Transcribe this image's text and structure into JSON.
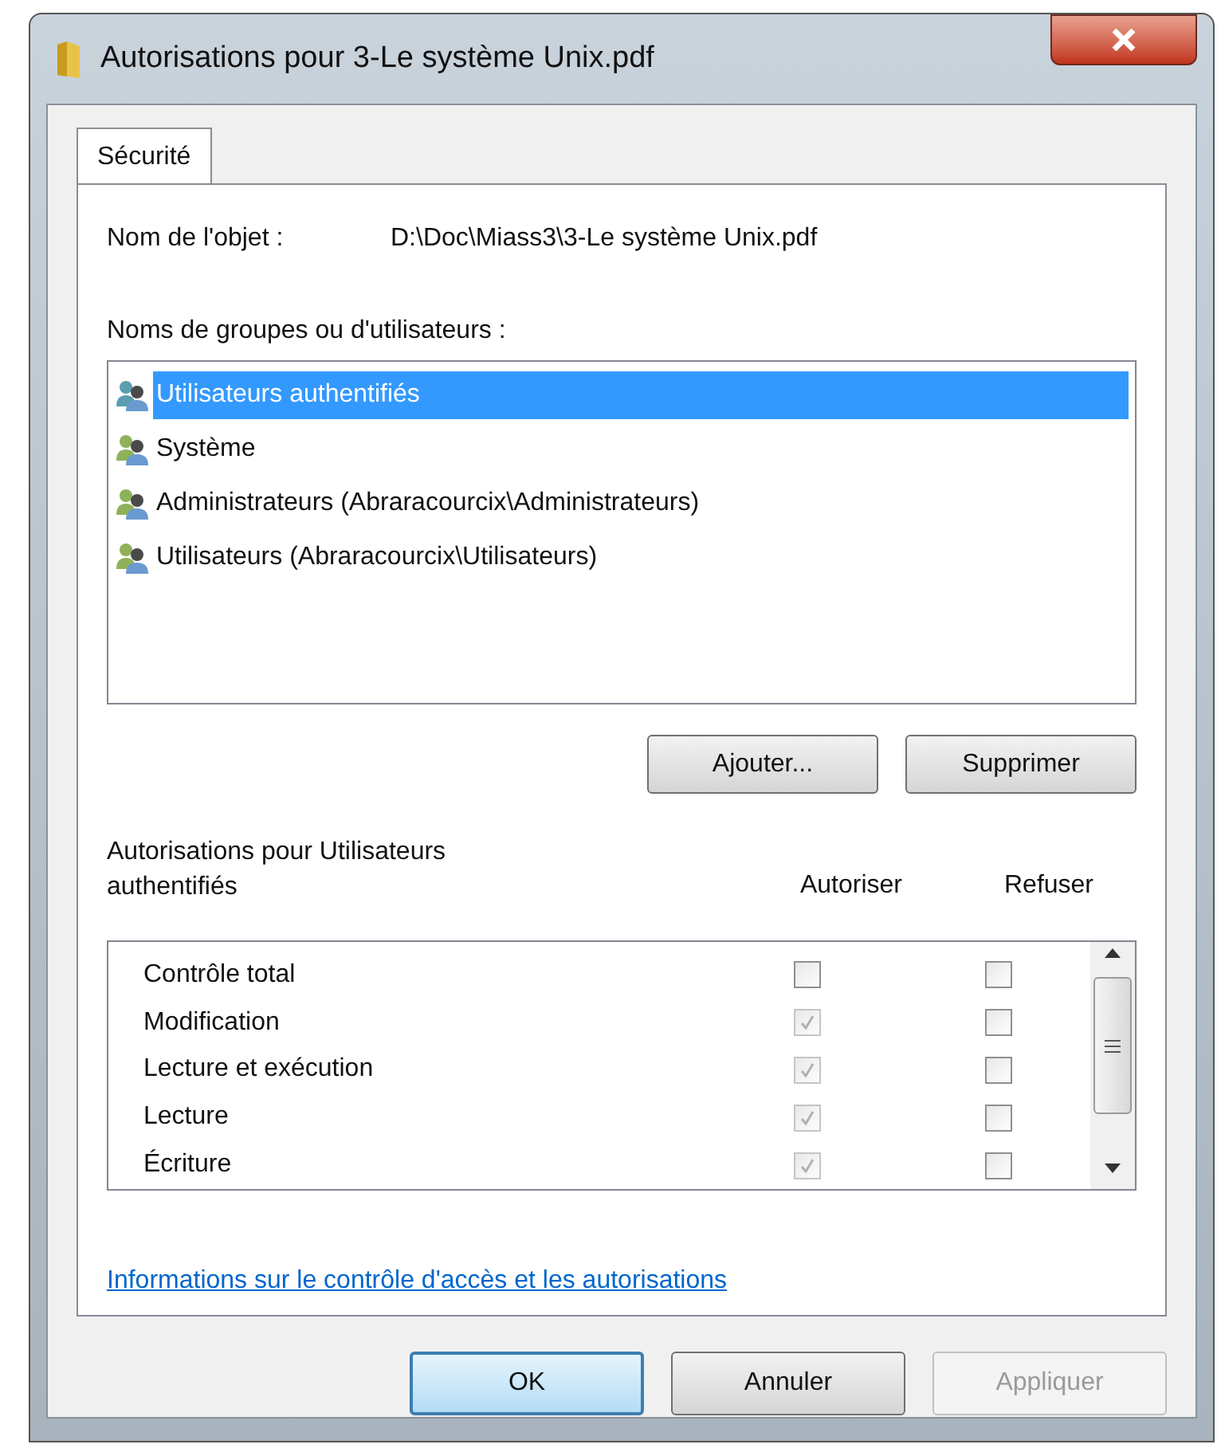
{
  "window": {
    "title": "Autorisations pour 3-Le système Unix.pdf"
  },
  "tabs": [
    {
      "label": "Sécurité",
      "selected": true
    }
  ],
  "object_name": {
    "label": "Nom de l'objet :",
    "value": "D:\\Doc\\Miass3\\3-Le système Unix.pdf"
  },
  "groups": {
    "label": "Noms de groupes ou d'utilisateurs :",
    "items": [
      {
        "name": "Utilisateurs authentifiés",
        "selected": true
      },
      {
        "name": "Système",
        "selected": false
      },
      {
        "name": "Administrateurs (Abraracourcix\\Administrateurs)",
        "selected": false
      },
      {
        "name": "Utilisateurs (Abraracourcix\\Utilisateurs)",
        "selected": false
      }
    ],
    "buttons": [
      {
        "label": "Ajouter..."
      },
      {
        "label": "Supprimer"
      }
    ]
  },
  "permissions": {
    "label": "Autorisations pour Utilisateurs authentifiés",
    "allow_header": "Autoriser",
    "deny_header": "Refuser",
    "rows": [
      {
        "name": "Contrôle total",
        "allow": {
          "checked": false,
          "disabled": false
        },
        "deny": {
          "checked": false,
          "disabled": false
        }
      },
      {
        "name": "Modification",
        "allow": {
          "checked": true,
          "disabled": true
        },
        "deny": {
          "checked": false,
          "disabled": false
        }
      },
      {
        "name": "Lecture et exécution",
        "allow": {
          "checked": true,
          "disabled": true
        },
        "deny": {
          "checked": false,
          "disabled": false
        }
      },
      {
        "name": "Lecture",
        "allow": {
          "checked": true,
          "disabled": true
        },
        "deny": {
          "checked": false,
          "disabled": false
        }
      },
      {
        "name": "Écriture",
        "allow": {
          "checked": true,
          "disabled": true
        },
        "deny": {
          "checked": false,
          "disabled": false
        }
      }
    ]
  },
  "link": "Informations sur le contrôle d'accès et les autorisations",
  "buttons": [
    {
      "label": "OK",
      "default": true,
      "disabled": false
    },
    {
      "label": "Annuler",
      "default": false,
      "disabled": false
    },
    {
      "label": "Appliquer",
      "default": false,
      "disabled": true
    }
  ]
}
